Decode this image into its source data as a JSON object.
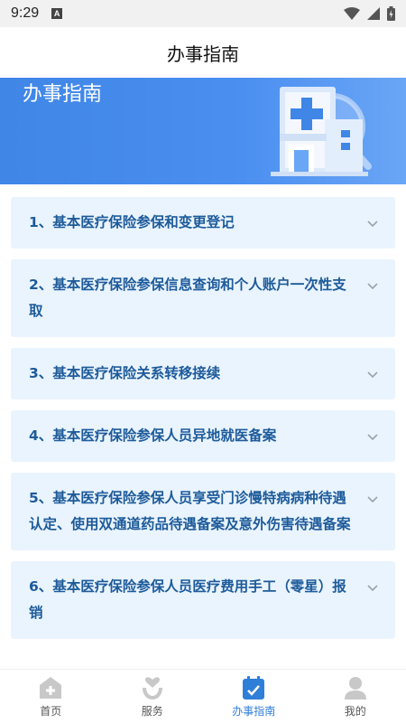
{
  "status_bar": {
    "time": "9:29",
    "badge": "A"
  },
  "header": {
    "title": "办事指南"
  },
  "banner": {
    "title": "办事指南"
  },
  "guide_items": [
    {
      "label": "1、基本医疗保险参保和变更登记"
    },
    {
      "label": "2、基本医疗保险参保信息查询和个人账户一次性支取"
    },
    {
      "label": "3、基本医疗保险关系转移接续"
    },
    {
      "label": "4、基本医疗保险参保人员异地就医备案"
    },
    {
      "label": "5、基本医疗保险参保人员享受门诊慢特病病种待遇认定、使用双通道药品待遇备案及意外伤害待遇备案"
    },
    {
      "label": "6、基本医疗保险参保人员医疗费用手工（零星）报销"
    }
  ],
  "tabbar": {
    "home": "首页",
    "service": "服务",
    "guide": "办事指南",
    "mine": "我的"
  },
  "colors": {
    "accent": "#2f7ed8",
    "item_text": "#1e5b9a",
    "item_bg": "#e9f4fe",
    "banner_start": "#3f86e6",
    "banner_end": "#6aa6f6"
  }
}
